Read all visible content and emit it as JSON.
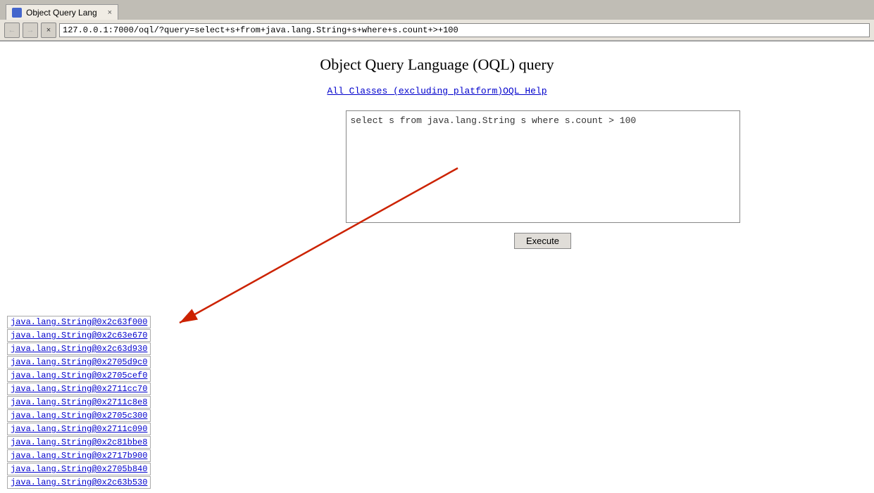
{
  "browser": {
    "tab_label": "Object Query Lang",
    "tab_close": "×",
    "nav": {
      "back": "←",
      "forward": "→",
      "stop": "×",
      "address": "127.0.0.1:7000/oql/?query=select+s+from+java.lang.String+s+where+s.count+>+100"
    }
  },
  "page": {
    "title": "Object Query Language (OQL) query",
    "links": {
      "all_classes": "All Classes (excluding platform)",
      "oql_help": "OQL Help"
    },
    "query_text": "select s from java.lang.String s where s.count > 100",
    "execute_button": "Execute",
    "results": [
      "java.lang.String@0x2c63f000",
      "java.lang.String@0x2c63e670",
      "java.lang.String@0x2c63d930",
      "java.lang.String@0x2705d9c0",
      "java.lang.String@0x2705cef0",
      "java.lang.String@0x2711cc70",
      "java.lang.String@0x2711c8e8",
      "java.lang.String@0x2705c300",
      "java.lang.String@0x2711c090",
      "java.lang.String@0x2c81bbe8",
      "java.lang.String@0x2717b900",
      "java.lang.String@0x2705b840",
      "java.lang.String@0x2c63b530"
    ]
  }
}
